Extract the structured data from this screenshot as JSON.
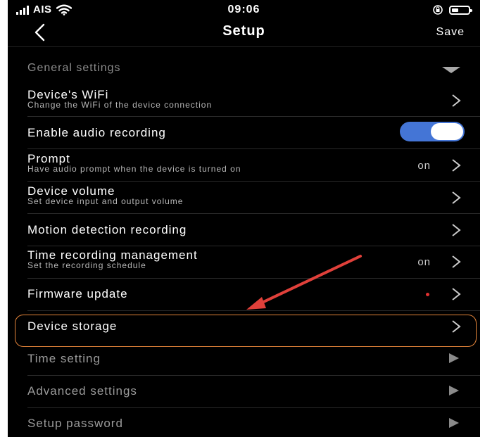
{
  "status_bar": {
    "carrier": "AIS",
    "time": "09:06"
  },
  "nav": {
    "title": "Setup",
    "save_label": "Save"
  },
  "section": {
    "title": "General settings"
  },
  "items": [
    {
      "title": "Device's  WiFi",
      "subtitle": "Change the WiFi of the device connection"
    },
    {
      "title": "Enable audio recording",
      "toggle_on": true
    },
    {
      "title": "Prompt",
      "subtitle": "Have audio prompt when the device is turned on",
      "value": "on"
    },
    {
      "title": "Device volume",
      "subtitle": "Set device input and output volume"
    },
    {
      "title": "Motion detection recording"
    },
    {
      "title": "Time recording management",
      "subtitle": "Set the recording schedule",
      "value": "on"
    },
    {
      "title": "Firmware update"
    },
    {
      "title": "Device storage"
    },
    {
      "title": "Time setting"
    },
    {
      "title": "Advanced settings"
    },
    {
      "title": "Setup password"
    }
  ],
  "icons": {
    "signal": "signal-bars-icon",
    "wifi": "wifi-icon",
    "rotation_lock": "rotation-lock-icon",
    "battery": "battery-icon",
    "back": "chevron-left-icon",
    "chevron": "chevron-right-icon",
    "expand": "triangle-down-icon",
    "disabled": "play-triangle-icon"
  },
  "colors": {
    "background": "#000000",
    "toggle_on": "#4475d6",
    "highlight": "#e5853a",
    "annotation_arrow": "#e0403a",
    "update_dot": "#e03030"
  }
}
